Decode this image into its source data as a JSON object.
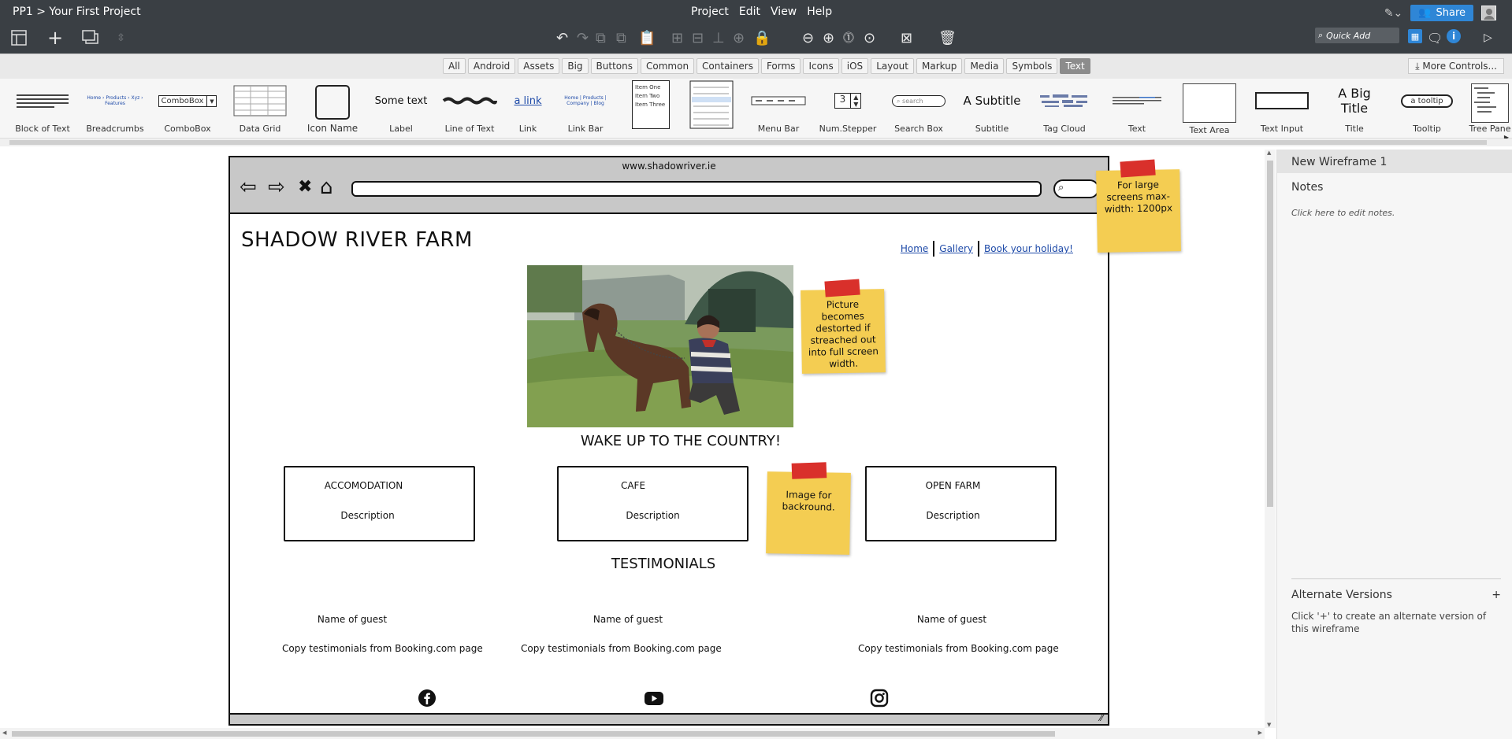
{
  "app": {
    "breadcrumb": "PP1 > Your First Project",
    "menus": [
      "Project",
      "Edit",
      "View",
      "Help"
    ],
    "share_label": "Share",
    "quick_add_placeholder": "Quick Add"
  },
  "tabs": {
    "items": [
      "All",
      "Android",
      "Assets",
      "Big",
      "Buttons",
      "Common",
      "Containers",
      "Forms",
      "Icons",
      "iOS",
      "Layout",
      "Markup",
      "Media",
      "Symbols",
      "Text"
    ],
    "active": "Text",
    "more_controls": "More Controls..."
  },
  "library": {
    "items": [
      "Block of Text",
      "Breadcrumbs",
      "ComboBox",
      "Data Grid",
      "Icon Name",
      "Label",
      "Line of Text",
      "Link",
      "Link Bar",
      "",
      "",
      "Menu Bar",
      "Num.Stepper",
      "Search Box",
      "Subtitle",
      "Tag Cloud",
      "Text",
      "Text Area",
      "Text Input",
      "Title",
      "Tooltip",
      "Tree Pane"
    ],
    "previews": {
      "combobox": "ComboBox",
      "label": "Some text",
      "link": "a link",
      "stepper": "3",
      "search": "search",
      "subtitle": "A Subtitle",
      "title": "A Big Title",
      "tooltip": "a tooltip",
      "list_items": [
        "Item One",
        "Item Two",
        "Item Three"
      ]
    }
  },
  "panel": {
    "wireframe_name": "New Wireframe 1",
    "notes_label": "Notes",
    "notes_placeholder": "Click here to edit notes.",
    "alt_versions_label": "Alternate Versions",
    "alt_plus": "+",
    "alt_desc": "Click '+' to create an alternate version of this wireframe"
  },
  "wireframe": {
    "url": "www.shadowriver.ie",
    "site_title": "SHADOW RIVER FARM",
    "nav": [
      "Home",
      "Gallery",
      "Book your holiday!"
    ],
    "hero_heading": "WAKE UP TO THE COUNTRY!",
    "cards": [
      {
        "title": "ACCOMODATION",
        "desc": "Description"
      },
      {
        "title": "CAFE",
        "desc": "Description"
      },
      {
        "title": "OPEN FARM",
        "desc": "Description"
      }
    ],
    "testimonials_heading": "TESTIMONIALS",
    "testimonials": [
      {
        "name": "Name of guest",
        "copy": "Copy testimonials from Booking.com page"
      },
      {
        "name": "Name of guest",
        "copy": "Copy testimonials from Booking.com page"
      },
      {
        "name": "Name of guest",
        "copy": "Copy testimonials from Booking.com page"
      }
    ],
    "social_icons": [
      "facebook-icon",
      "youtube-icon",
      "instagram-icon"
    ]
  },
  "stickies": {
    "large_screens": "For large screens max-width: 1200px",
    "picture": "Picture becomes destorted if streached out into full screen width.",
    "background": "Image for backround."
  },
  "colors": {
    "chrome_dark": "#3a3f44",
    "share_blue": "#2f86d6",
    "sticky_yellow": "#f4cd52",
    "tape_red": "#d9302b",
    "link_blue": "#1e4aa8"
  }
}
